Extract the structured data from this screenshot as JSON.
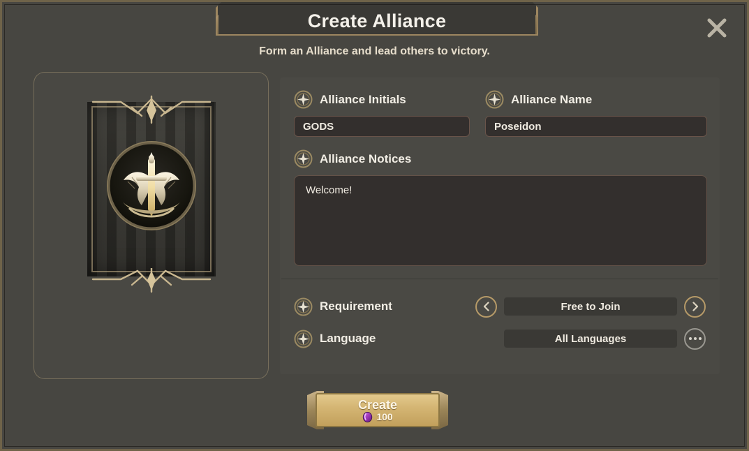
{
  "window": {
    "title": "Create Alliance",
    "subtitle": "Form an Alliance and lead others to victory.",
    "close_icon": "close-icon"
  },
  "emblem": {
    "icon_name": "alliance-crest-winged-sword",
    "banner_icon": "alliance-banner"
  },
  "form": {
    "initials": {
      "label": "Alliance Initials",
      "value": "GODS",
      "placeholder": "Alliance Initials",
      "bullet_icon": "medallion-icon"
    },
    "name": {
      "label": "Alliance Name",
      "value": "Poseidon",
      "placeholder": "Alliance Name",
      "bullet_icon": "medallion-icon"
    },
    "notices": {
      "label": "Alliance Notices",
      "value": "Welcome!",
      "placeholder": "Alliance Notices",
      "bullet_icon": "medallion-icon"
    }
  },
  "settings": {
    "requirement": {
      "label": "Requirement",
      "value": "Free to Join",
      "bullet_icon": "medallion-icon",
      "prev_icon": "chevron-left-icon",
      "next_icon": "chevron-right-icon"
    },
    "language": {
      "label": "Language",
      "value": "All Languages",
      "bullet_icon": "medallion-icon",
      "more_icon": "ellipsis-icon"
    }
  },
  "create_button": {
    "label": "Create",
    "cost_value": "100",
    "cost_icon": "gem-icon"
  },
  "colors": {
    "accent_gold": "#c2a05c",
    "panel": "#4a4944",
    "input": "#332f2d",
    "frame_border": "#6f6349",
    "gem_purple": "#a43bbd",
    "text_primary": "#f2eee5"
  }
}
